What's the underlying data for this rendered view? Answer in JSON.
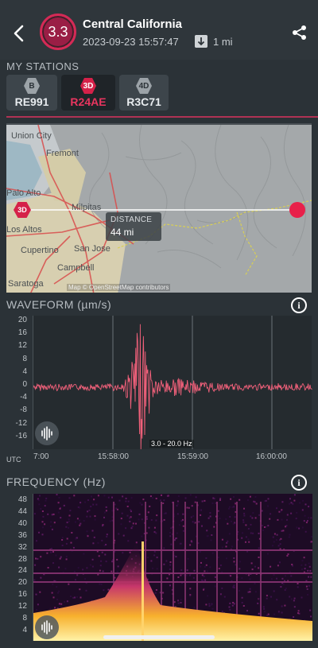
{
  "header": {
    "magnitude": "3.3",
    "title": "Central California",
    "datetime": "2023-09-23 15:57:47",
    "depth": "1 mi",
    "back_icon": "chevron-left-icon",
    "share_icon": "share-icon",
    "depth_icon": "arrow-down-icon"
  },
  "stations": {
    "label": "MY STATIONS",
    "items": [
      {
        "badge": "B",
        "code": "RE991"
      },
      {
        "badge": "3D",
        "code": "R24AE"
      },
      {
        "badge": "4D",
        "code": "R3C71"
      }
    ]
  },
  "map": {
    "distance_label": "DISTANCE",
    "distance_value": "44 mi",
    "station_badge": "3D",
    "credit": "Map © OpenStreetMap contributors",
    "cities": [
      "Union City",
      "Fremont",
      "Palo Alto",
      "Milpitas",
      "Los Altos",
      "San Jose",
      "Cupertino",
      "Campbell",
      "Saratoga"
    ]
  },
  "waveform": {
    "label": "WAVEFORM (µm/s)",
    "band": "3.0 - 20.0 Hz",
    "utc": "UTC",
    "y_ticks": [
      "20",
      "16",
      "12",
      "8",
      "4",
      "0",
      "-4",
      "-8",
      "-12",
      "-16"
    ],
    "x_ticks": [
      "7:00",
      "15:58:00",
      "15:59:00",
      "16:00:00"
    ]
  },
  "frequency": {
    "label": "FREQUENCY (Hz)",
    "y_ticks": [
      "48",
      "44",
      "40",
      "36",
      "32",
      "28",
      "24",
      "20",
      "16",
      "12",
      "8",
      "4"
    ]
  },
  "colors": {
    "accent": "#d52149",
    "waveform": "#f0607a",
    "background": "#2b3237"
  }
}
